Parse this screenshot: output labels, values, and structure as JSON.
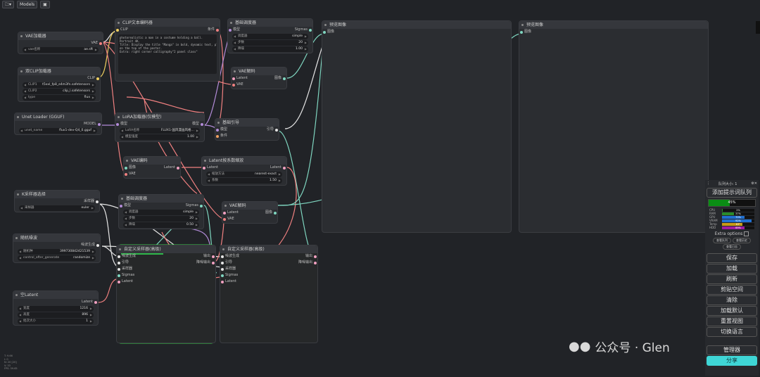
{
  "toolbar": {
    "folder_label": "▾",
    "models_label": "Models"
  },
  "nodes": {
    "vae_loader": {
      "title": "VAE加载器",
      "out": "VAE",
      "w": [
        {
          "l": "vae名称",
          "v": "ae.sft"
        }
      ]
    },
    "dual_clip": {
      "title": "双CLIP加载器",
      "out": "CLIP",
      "w": [
        {
          "l": "CLIP1",
          "v": "t5xxl_fp8_e4m3fn.safetensors"
        },
        {
          "l": "CLIP2",
          "v": "clip_l.safetensors"
        },
        {
          "l": "type",
          "v": "flux"
        }
      ]
    },
    "unet": {
      "title": "Unet Loader (GGUF)",
      "out": "MODEL",
      "w": [
        {
          "l": "unet_name",
          "v": "flux1-dev-Q4_0.gguf"
        }
      ]
    },
    "clip_text": {
      "title": "CLIP文本编码器",
      "in": "CLIP",
      "out": "条件",
      "text": "photorealistic a man in a costume holding a ball.\nPortrait 4K.\nTitle: Display the title \"Manga\" in bold, dynamic text, placed vertically\non the top of the poster.\nExtra: right corner calligraphy\"2 panel class\""
    },
    "lora": {
      "title": "LoRA加载器(仅模型)",
      "in": "模型",
      "out": "模型",
      "w": [
        {
          "l": "LoRA名称",
          "v": "FLUX1-国风漫画风格…"
        },
        {
          "l": "模型强度",
          "v": "1.00"
        }
      ]
    },
    "basic_sched": {
      "title": "基础调度器",
      "in": "模型",
      "out": "Sigmas",
      "w": [
        {
          "l": "调度器",
          "v": "simple"
        },
        {
          "l": "步数",
          "v": "20"
        },
        {
          "l": "降噪",
          "v": "1.00"
        }
      ]
    },
    "vae_decode1": {
      "title": "VAE解码",
      "in1": "Latent",
      "in2": "VAE",
      "out": "图像"
    },
    "basic_guide": {
      "title": "基础引导",
      "in1": "模型",
      "in2": "条件",
      "out": "引导"
    },
    "vae_encode": {
      "title": "VAE编码",
      "in1": "图像",
      "in2": "VAE",
      "out": "Latent"
    },
    "latent_upscale": {
      "title": "Latent按系数缩放",
      "in": "Latent",
      "out": "Latent",
      "w": [
        {
          "l": "缩放方法",
          "v": "nearest-exact"
        },
        {
          "l": "系数",
          "v": "1.50"
        }
      ]
    },
    "ksampler_select": {
      "title": "K采样器选择",
      "out": "采样器",
      "w": [
        {
          "l": "采样器",
          "v": "euler"
        }
      ]
    },
    "basic_sched2": {
      "title": "基础调度器",
      "in": "模型",
      "out": "Sigmas",
      "w": [
        {
          "l": "调度器",
          "v": "simple"
        },
        {
          "l": "步数",
          "v": "20"
        },
        {
          "l": "降噪",
          "v": "0.50"
        }
      ]
    },
    "vae_decode2": {
      "title": "VAE解码",
      "in1": "Latent",
      "in2": "VAE",
      "out": "图像"
    },
    "noise": {
      "title": "随机噪波",
      "out": "噪波生成",
      "w": [
        {
          "l": "随机种",
          "v": "399730842421539"
        },
        {
          "l": "control_after_generate",
          "v": "randomize"
        }
      ]
    },
    "custom_sampler1": {
      "title": "自定义采样器(高级)",
      "ins": [
        "噪波生成",
        "引导",
        "采样器",
        "Sigmas",
        "Latent"
      ],
      "outs": [
        "输出",
        "降噪输出"
      ]
    },
    "custom_sampler2": {
      "title": "自定义采样器(高级)",
      "ins": [
        "噪波生成",
        "引导",
        "采样器",
        "Sigmas",
        "Latent"
      ],
      "outs": [
        "输出",
        "降噪输出"
      ]
    },
    "empty_latent": {
      "title": "空Latent",
      "out": "Latent",
      "w": [
        {
          "l": "宽度",
          "v": "1216"
        },
        {
          "l": "高度",
          "v": "896"
        },
        {
          "l": "批次大小",
          "v": "1"
        }
      ]
    },
    "preview1": {
      "title": "预览图像",
      "in": "图像"
    },
    "preview2": {
      "title": "预览图像",
      "in": "图像"
    }
  },
  "panel": {
    "queue_size": "队列大小: 1",
    "add_prompt": "添加提示词队列",
    "progress": "45%",
    "progress_value": 0.45,
    "stats": [
      {
        "l": "CPU",
        "v": "2%",
        "f": 0.02,
        "c": "#2a8c2a"
      },
      {
        "l": "RAM",
        "v": "37%",
        "f": 0.37,
        "c": "#2a8c2a"
      },
      {
        "l": "GPU",
        "v": "70%",
        "f": 0.7,
        "c": "#1f6fd1"
      },
      {
        "l": "VRAM",
        "v": "92%",
        "f": 0.92,
        "c": "#1f6fd1"
      },
      {
        "l": "Temp",
        "v": "63°",
        "f": 0.63,
        "c": "#c89a18"
      },
      {
        "l": "HDD",
        "v": "69%",
        "f": 0.69,
        "c": "#a01ca0"
      }
    ],
    "extra_options": "Extra options",
    "queue_btn1": "查看队列",
    "queue_btn2": "查看历史",
    "queue_btn3": "查看日志",
    "buttons": [
      "保存",
      "加载",
      "刷新",
      "剪贴空间",
      "清除",
      "加载默认",
      "重置视图",
      "切换语言"
    ],
    "manager": "管理器",
    "share": "分享"
  },
  "watermark": "公众号 · Glen",
  "fps_text": "T: 9.66\nI: 0\nN: 20 [20]\nV: 33\nFPS: 59.65"
}
